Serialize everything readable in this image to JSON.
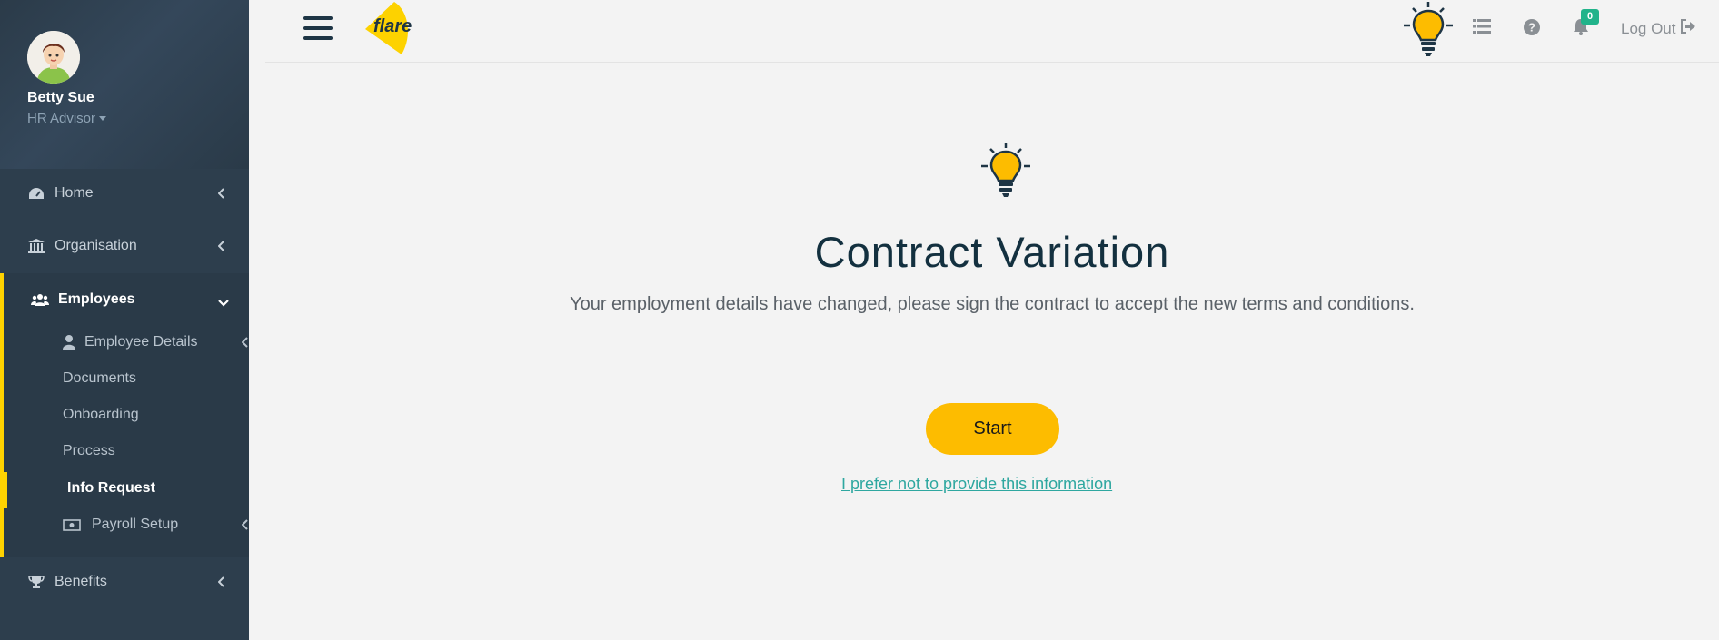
{
  "user": {
    "name": "Betty Sue",
    "role": "HR Advisor"
  },
  "nav": {
    "home": "Home",
    "organisation": "Organisation",
    "employees": "Employees",
    "benefits": "Benefits",
    "sub_items": [
      "Employee Details",
      "Documents",
      "Onboarding",
      "Process",
      "Info Request",
      "Payroll Setup"
    ],
    "active_item": "Info Request"
  },
  "topbar": {
    "logo_text": "flare",
    "notification_count": "0",
    "logout_label": "Log Out"
  },
  "main": {
    "title": "Contract Variation",
    "subtitle": "Your employment details have changed, please sign the contract to accept the new terms and conditions.",
    "start_label": "Start",
    "decline_label": "I prefer not to provide this information"
  },
  "colors": {
    "sidebar_bg": "#2d3e4d",
    "accent_yellow": "#ffd200",
    "button_yellow": "#fdbc00",
    "link_teal": "#2ea7a0",
    "badge_green": "#21b38a",
    "title_dark": "#13303f"
  },
  "icons": [
    "dashboard-icon",
    "bank-icon",
    "users-icon",
    "user-icon",
    "money-icon",
    "trophy-icon",
    "hamburger-icon",
    "lightbulb-icon",
    "list-icon",
    "help-icon",
    "bell-icon",
    "logout-icon",
    "chevron-left-icon",
    "chevron-down-icon"
  ]
}
